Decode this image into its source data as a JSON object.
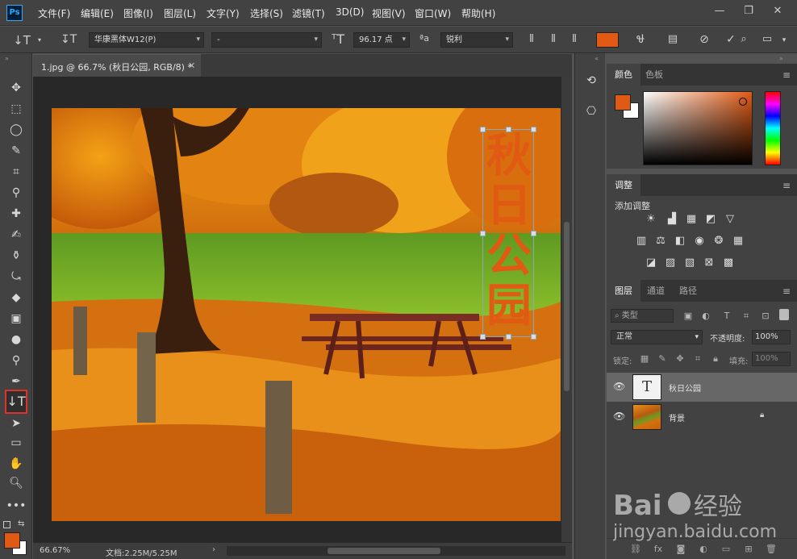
{
  "menubar": {
    "logo": "Ps",
    "items": [
      "文件(F)",
      "编辑(E)",
      "图像(I)",
      "图层(L)",
      "文字(Y)",
      "选择(S)",
      "滤镜(T)",
      "3D(D)",
      "视图(V)",
      "窗口(W)",
      "帮助(H)"
    ],
    "minimize": "—",
    "restore": "❐",
    "close": "✕"
  },
  "options": {
    "font_family": "华康黑体W12(P)",
    "font_style": "-",
    "font_size": "96.17 点",
    "antialias": "锐利"
  },
  "document": {
    "tab_title": "1.jpg @ 66.7% (秋日公园, RGB/8) *",
    "zoom": "66.67%",
    "doc_info": "文档:2.25M/5.25M",
    "vertical_text": [
      "秋",
      "日",
      "公",
      "园"
    ]
  },
  "panels": {
    "color_tabs": [
      "颜色",
      "色板"
    ],
    "adjust_tab": "调整",
    "add_adjustment": "添加调整",
    "layers_tabs": [
      "图层",
      "通道",
      "路径"
    ],
    "filter_kind": "类型",
    "blend_mode": "正常",
    "opacity_label": "不透明度:",
    "opacity_value": "100%",
    "lock_label": "锁定:",
    "fill_label": "填充:",
    "fill_value": "100%",
    "layers": [
      {
        "name": "秋日公园",
        "type": "text"
      },
      {
        "name": "背景",
        "type": "image"
      }
    ]
  },
  "colors": {
    "foreground": "#e05a14",
    "background": "#ffffff",
    "text_layer": "#e05a14"
  },
  "watermark": "Baidu经验 jingyan.baidu.com"
}
